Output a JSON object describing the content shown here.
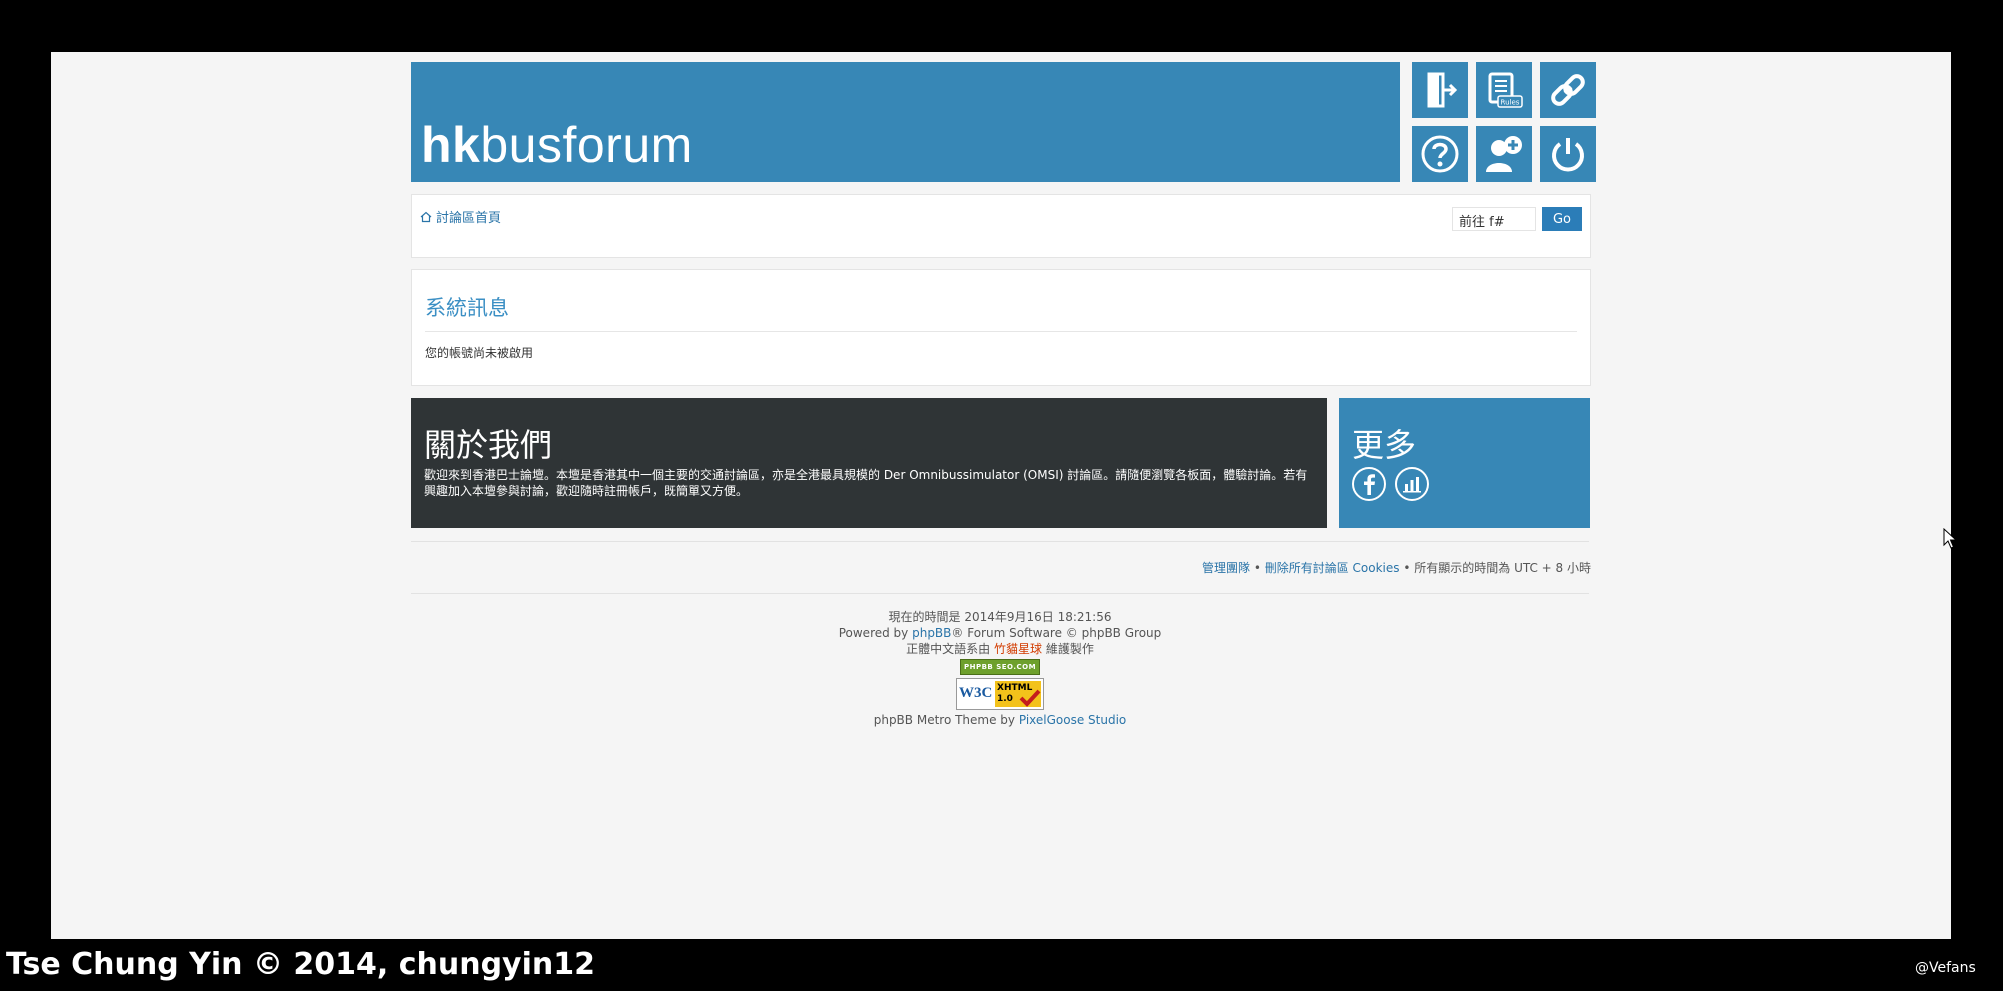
{
  "header": {
    "logo_bold": "hk",
    "logo_rest": "busforum",
    "tiles": [
      {
        "icon": "door-exit-icon"
      },
      {
        "icon": "rules-document-icon",
        "label": "Rules"
      },
      {
        "icon": "link-icon"
      },
      {
        "icon": "question-icon"
      },
      {
        "icon": "add-user-icon"
      },
      {
        "icon": "power-icon"
      }
    ]
  },
  "navbar": {
    "breadcrumb_home": "討論區首頁",
    "jump_placeholder": "前往 f#",
    "go_label": "Go"
  },
  "message": {
    "title": "系統訊息",
    "text": "您的帳號尚未被啟用"
  },
  "about": {
    "title": "關於我們",
    "text": "歡迎來到香港巴士論壇。本壇是香港其中一個主要的交通討論區，亦是全港最具規模的 Der Omnibussimulator (OMSI) 討論區。請隨便瀏覽各板面，體驗討論。若有興趣加入本壇參與討論，歡迎隨時註冊帳戶，既簡單又方便。"
  },
  "more": {
    "title": "更多",
    "icons": [
      "facebook-icon",
      "stats-icon"
    ]
  },
  "footer": {
    "team_link": "管理團隊",
    "sep1": " • ",
    "cookies_link": "刪除所有討論區 Cookies",
    "sep2": " • ",
    "timezone": "所有顯示的時間為 UTC + 8 小時"
  },
  "copyright": {
    "current_time": "現在的時間是 2014年9月16日 18:21:56",
    "powered_pre": "Powered by ",
    "phpbb_link": "phpBB",
    "powered_post": "® Forum Software © phpBB Group",
    "translation_pre": "正體中文語系由 ",
    "translation_link": "竹貓星球",
    "translation_post": " 維護製作",
    "seo_badge": "PHPBB SEO.COM",
    "w3c_left": "W3C",
    "w3c_right": "XHTML 1.0",
    "theme_pre": "phpBB Metro Theme by ",
    "theme_link": "PixelGoose Studio"
  },
  "overlay": {
    "credit": "Tse Chung Yin  © 2014, chungyin12",
    "tag": "@Vefans"
  }
}
